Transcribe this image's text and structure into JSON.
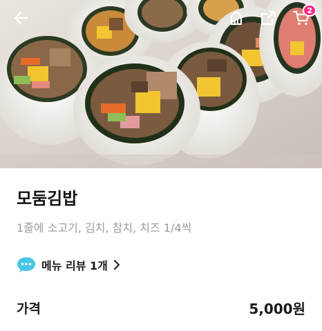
{
  "product": {
    "name": "모둠김밥",
    "description": "1줄에 소고기, 김치, 참치, 치즈 1/4씩",
    "review_link": "메뉴 리뷰 1개",
    "price_label": "가격",
    "price": "5,000원"
  },
  "header": {
    "icons": [
      "arrow-left-icon",
      "home-icon",
      "share-icon",
      "cart-icon"
    ],
    "cart_count": "2"
  },
  "colors": {
    "badge": "#ff2d87",
    "review_icon": "#45c6e8"
  }
}
